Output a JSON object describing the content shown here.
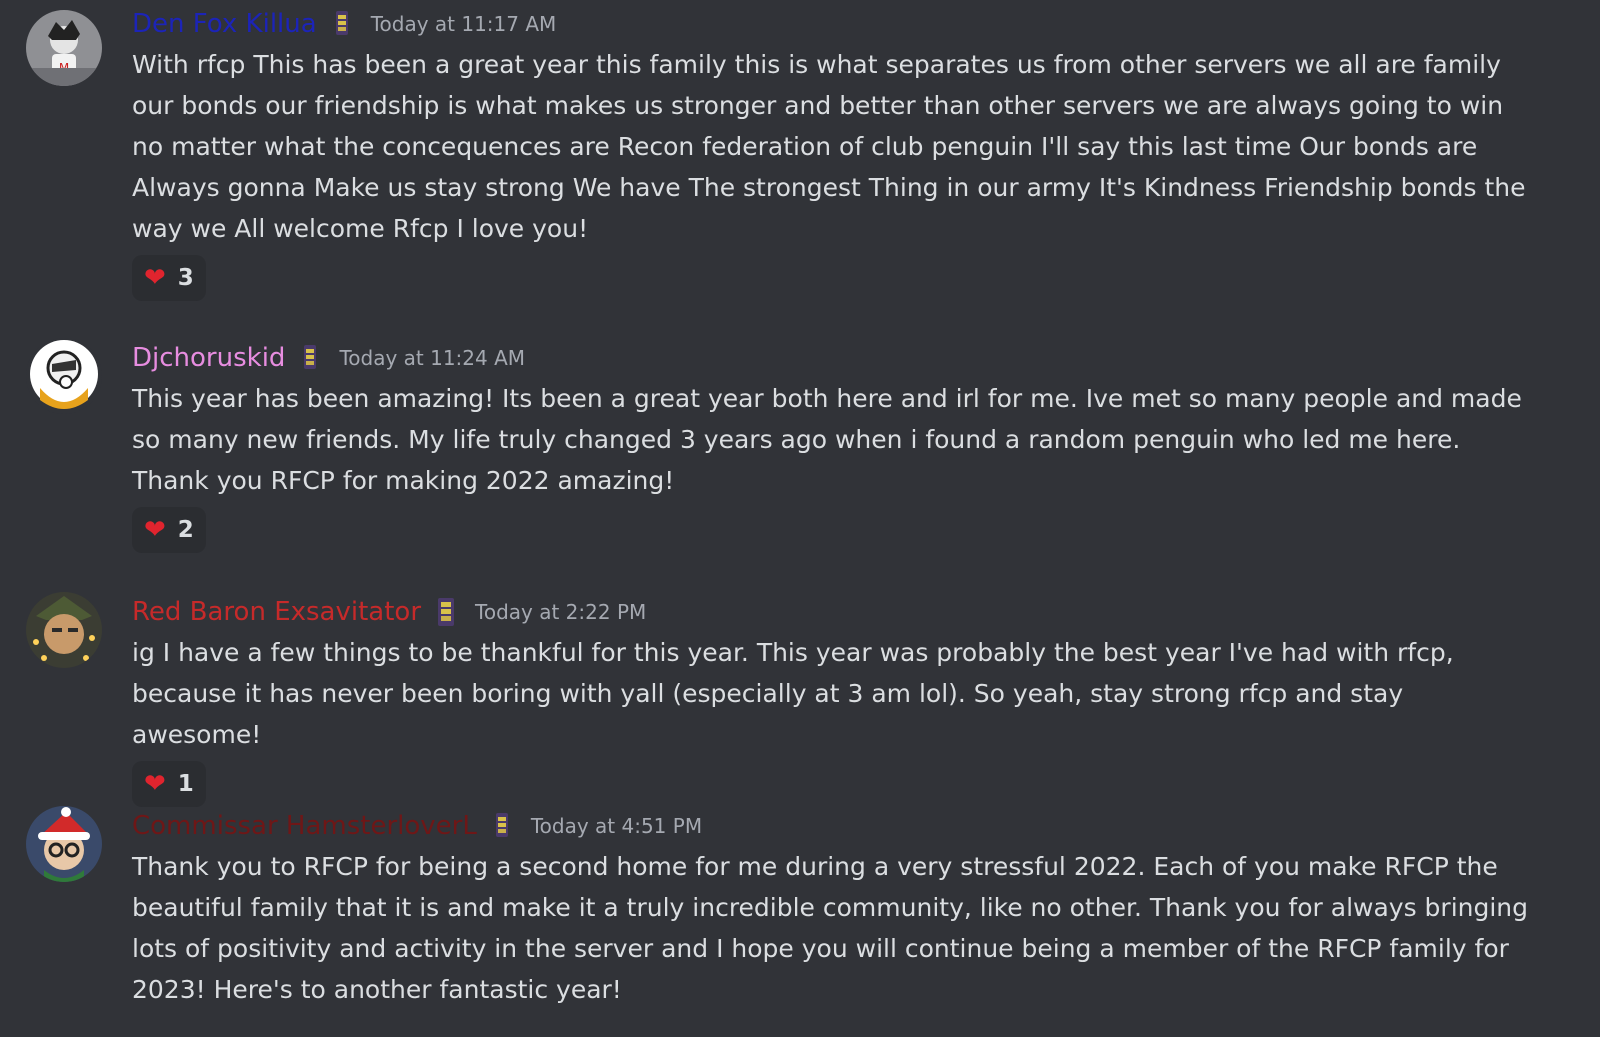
{
  "colors": {
    "background": "#313338",
    "reaction_bg": "#2b2d31",
    "timestamp": "#a5a9b1",
    "body_text": "#dbdee1",
    "heart": "#e0242e"
  },
  "messages": [
    {
      "username": "Den Fox Killua",
      "username_color": "#1c24b8",
      "role_icon": "rank-badge-icon",
      "timestamp": "Today at 11:17 AM",
      "text": "With rfcp This has been a great year this family this is what separates us from other servers we all are family our bonds our friendship is what makes us stronger and better than other servers  we are always going to win no matter what the concequences are Recon federation of club penguin I'll say this last time Our bonds are Always gonna Make us stay strong  We have The strongest Thing in our army It's Kindness Friendship bonds the way we All welcome Rfcp I love you!",
      "reaction": {
        "emoji": "❤",
        "emoji_name": "heart-icon",
        "count": "3"
      }
    },
    {
      "username": "Djchoruskid",
      "username_color": "#e78de0",
      "role_icon": "rank-badge-icon",
      "timestamp": "Today at 11:24 AM",
      "text": "This year has been amazing! Its been a great year both here and irl for me. Ive met so many people and made so many new friends. My life truly changed 3 years ago when i found a random penguin who led me here. Thank you RFCP for making 2022 amazing!",
      "reaction": {
        "emoji": "❤",
        "emoji_name": "heart-icon",
        "count": "2"
      }
    },
    {
      "username": "Red Baron Exsavitator",
      "username_color": "#c62a2a",
      "role_icon": "rank-badge-icon",
      "timestamp": "Today at 2:22 PM",
      "text": "ig I have a few things to be thankful for this year. This year was probably the best year I've had with rfcp, because it has never been boring with yall (especially at 3 am lol). So yeah, stay strong rfcp and stay awesome!",
      "reaction": {
        "emoji": "❤",
        "emoji_name": "heart-icon",
        "count": "1"
      }
    },
    {
      "username": "Commissar HamsterloverL",
      "username_color": "#6e1717",
      "role_icon": "rank-badge-icon",
      "timestamp": "Today at 4:51 PM",
      "text": "Thank you to RFCP for being a second home for me during a very stressful 2022.  Each of you make RFCP the beautiful family that it is and make it a truly incredible community, like no other.  Thank you for always bringing lots of positivity and activity in the server and I hope you will continue being a member of the RFCP family for 2023!  Here's to another fantastic year!"
    }
  ]
}
